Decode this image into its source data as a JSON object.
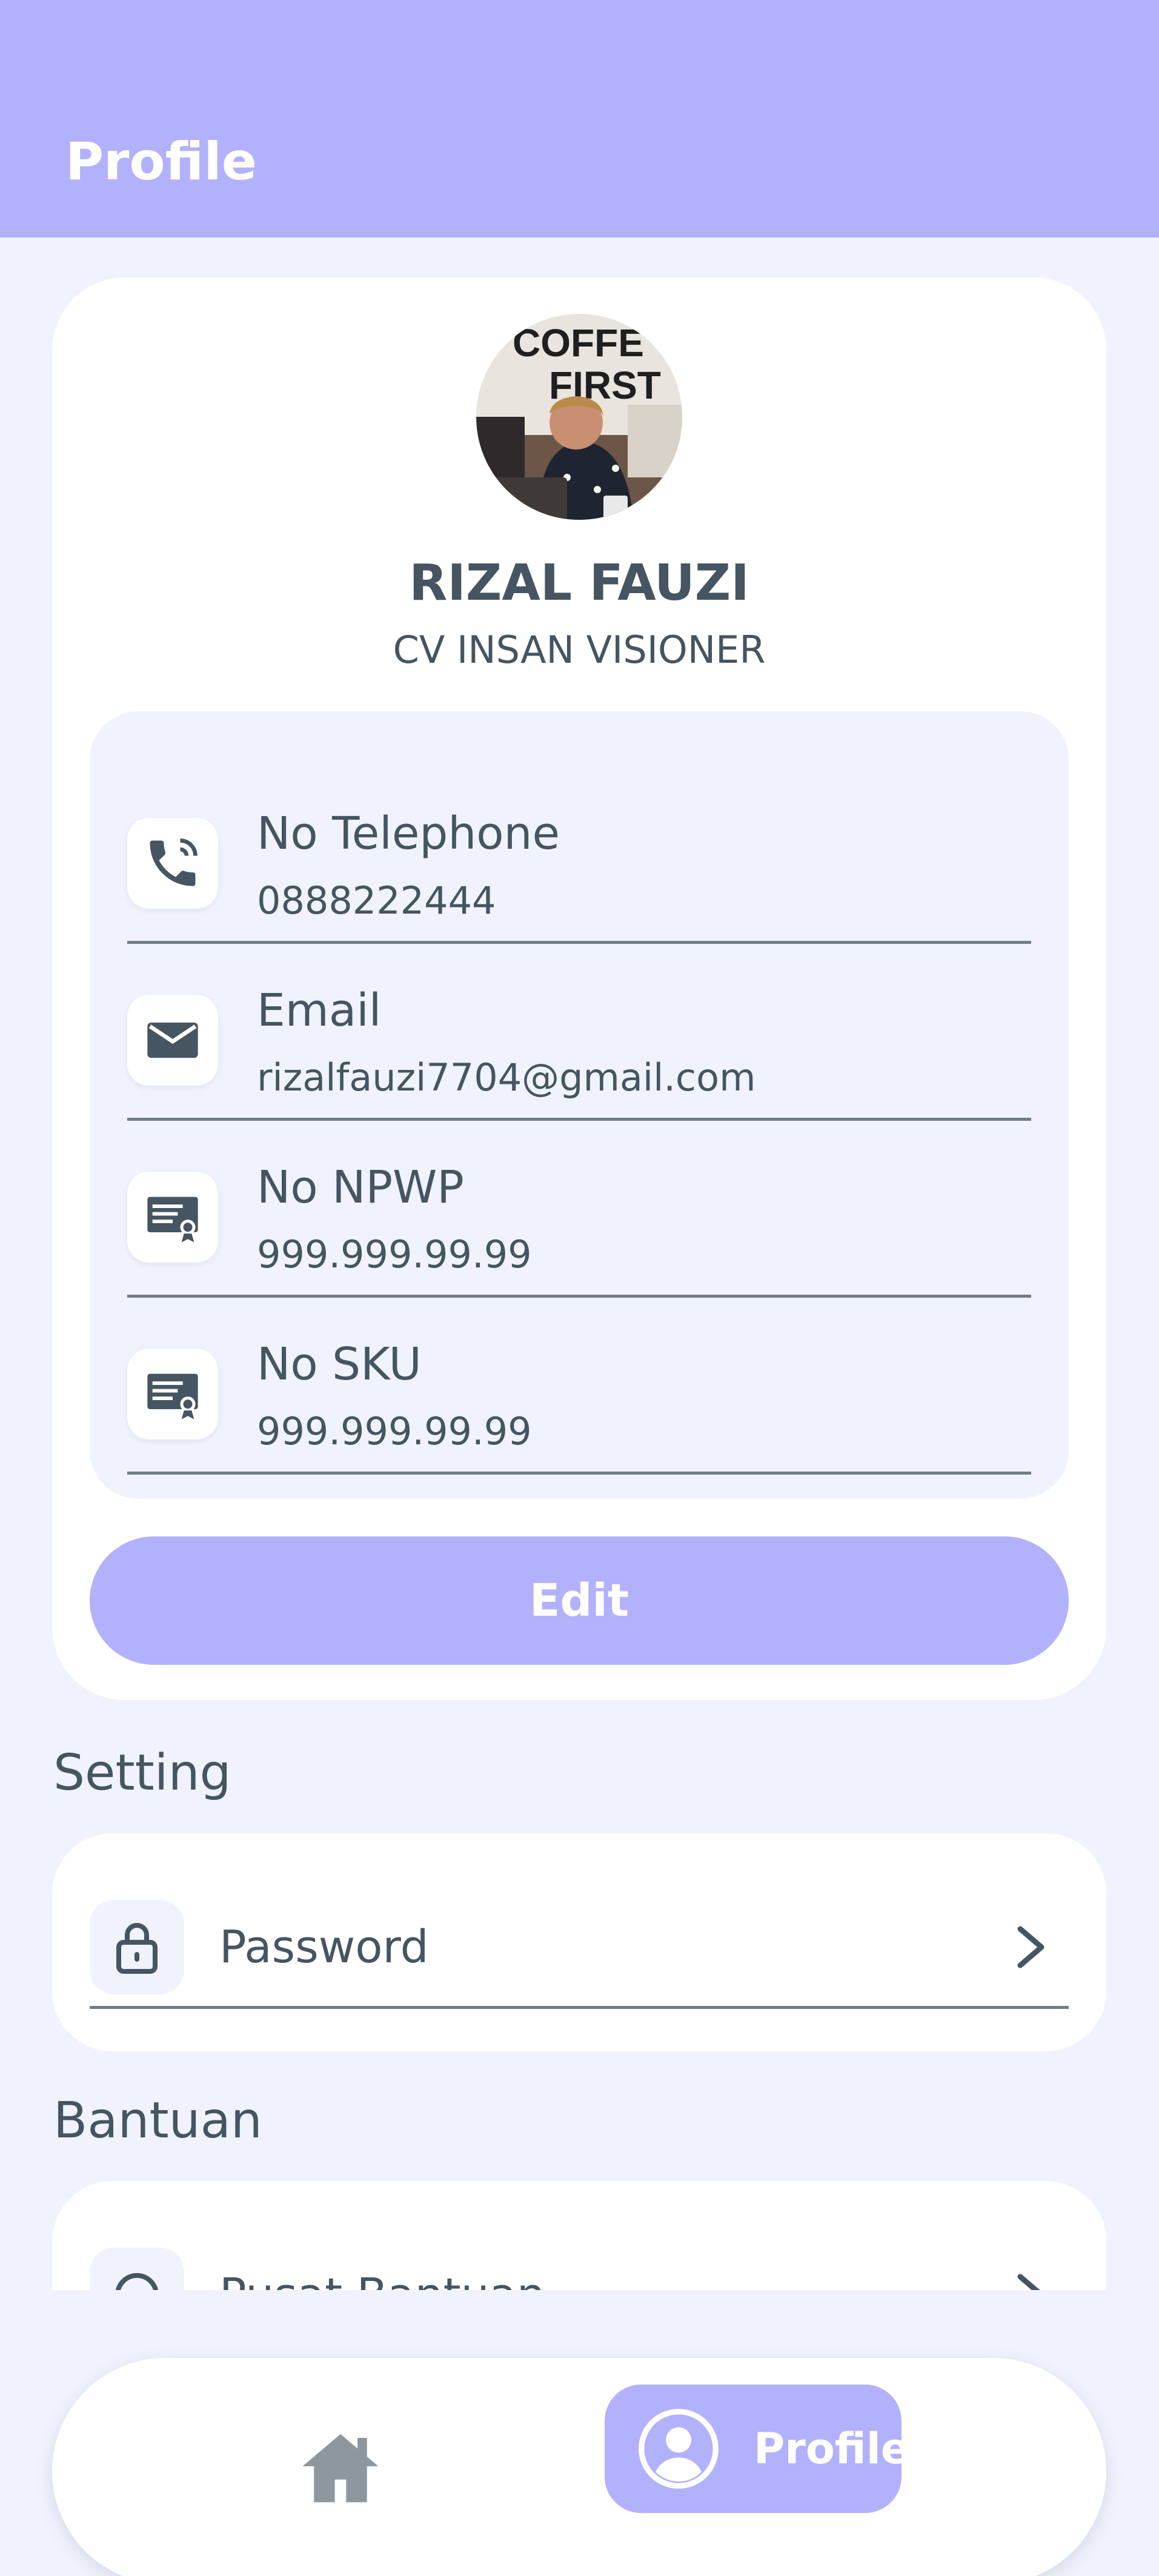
{
  "header": {
    "title": "Profile"
  },
  "profile": {
    "name": "RIZAL FAUZI",
    "company": "CV INSAN VISIONER",
    "avatar_text": [
      "COFFE",
      "FIRST"
    ],
    "info": [
      {
        "label": "No Telephone",
        "value": "0888222444",
        "icon": "phone-icon"
      },
      {
        "label": "Email",
        "value": "rizalfauzi7704@gmail.com",
        "icon": "mail-icon"
      },
      {
        "label": "No NPWP",
        "value": "999.999.99.99",
        "icon": "certificate-icon"
      },
      {
        "label": "No SKU",
        "value": "999.999.99.99",
        "icon": "certificate-icon"
      }
    ],
    "edit_label": "Edit"
  },
  "setting": {
    "title": "Setting",
    "items": [
      {
        "label": "Password",
        "icon": "lock-icon"
      }
    ]
  },
  "bantuan": {
    "title": "Bantuan",
    "items": [
      {
        "label": "Pusat Bantuan",
        "icon": "headset-icon"
      }
    ]
  },
  "bottom_nav": {
    "home_icon": "home-icon",
    "profile_label": "Profile"
  },
  "colors": {
    "accent": "#B2B1FC",
    "background": "#F0F3FD",
    "text": "#455561",
    "card": "#FFFFFF"
  }
}
